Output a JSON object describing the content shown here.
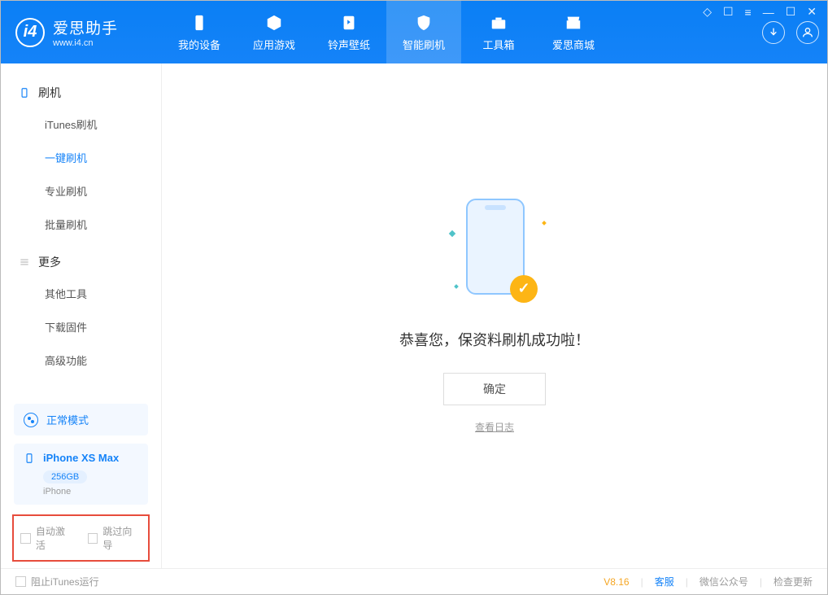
{
  "header": {
    "app_title": "爱思助手",
    "app_subtitle": "www.i4.cn",
    "tabs": [
      {
        "label": "我的设备"
      },
      {
        "label": "应用游戏"
      },
      {
        "label": "铃声壁纸"
      },
      {
        "label": "智能刷机"
      },
      {
        "label": "工具箱"
      },
      {
        "label": "爱思商城"
      }
    ]
  },
  "sidebar": {
    "flash_header": "刷机",
    "flash_items": [
      {
        "label": "iTunes刷机"
      },
      {
        "label": "一键刷机"
      },
      {
        "label": "专业刷机"
      },
      {
        "label": "批量刷机"
      }
    ],
    "more_header": "更多",
    "more_items": [
      {
        "label": "其他工具"
      },
      {
        "label": "下载固件"
      },
      {
        "label": "高级功能"
      }
    ],
    "mode_label": "正常模式",
    "device_name": "iPhone XS Max",
    "device_storage": "256GB",
    "device_type": "iPhone",
    "auto_activate": "自动激活",
    "skip_wizard": "跳过向导"
  },
  "content": {
    "success_msg": "恭喜您，保资料刷机成功啦！",
    "ok_button": "确定",
    "view_log": "查看日志"
  },
  "footer": {
    "block_itunes": "阻止iTunes运行",
    "version": "V8.16",
    "support": "客服",
    "wechat": "微信公众号",
    "check_update": "检查更新"
  }
}
